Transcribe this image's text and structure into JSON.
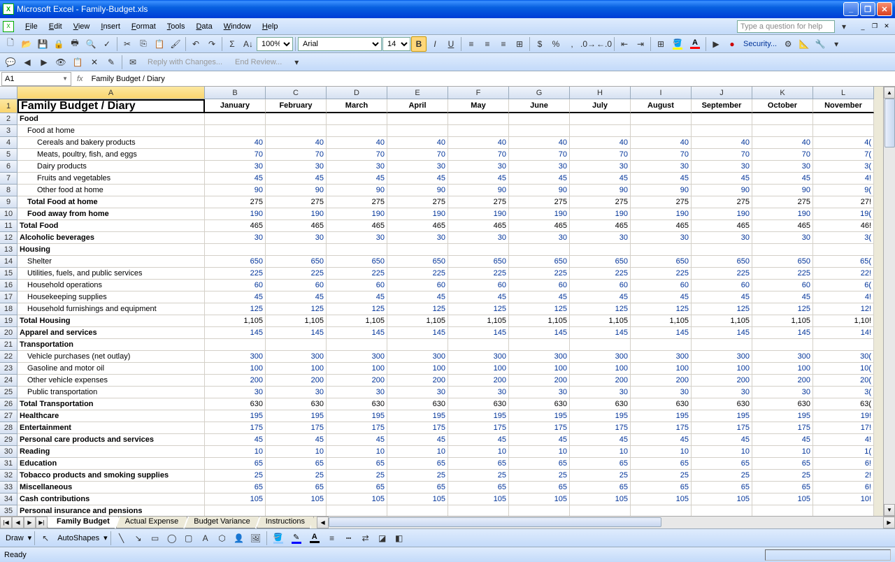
{
  "window": {
    "app": "Microsoft Excel",
    "doc": "Family-Budget.xls",
    "title": "Microsoft Excel - Family-Budget.xls"
  },
  "menus": [
    "File",
    "Edit",
    "View",
    "Insert",
    "Format",
    "Tools",
    "Data",
    "Window",
    "Help"
  ],
  "help_placeholder": "Type a question for help",
  "toolbar": {
    "zoom": "100%",
    "font": "Arial",
    "size": "14",
    "security": "Security..."
  },
  "review": {
    "reply": "Reply with Changes...",
    "end": "End Review..."
  },
  "namebox": "A1",
  "formula": "Family Budget / Diary",
  "columns": [
    "A",
    "B",
    "C",
    "D",
    "E",
    "F",
    "G",
    "H",
    "I",
    "J",
    "K",
    "L"
  ],
  "months": [
    "January",
    "February",
    "March",
    "April",
    "May",
    "June",
    "July",
    "August",
    "September",
    "October",
    "November"
  ],
  "rows": [
    {
      "n": 1,
      "a": "Family Budget / Diary",
      "style": "title"
    },
    {
      "n": 2,
      "a": "Food",
      "bold": true
    },
    {
      "n": 3,
      "a": "Food at home",
      "indent": 1
    },
    {
      "n": 4,
      "a": "Cereals and bakery products",
      "indent": 2,
      "v": 40,
      "last": "4("
    },
    {
      "n": 5,
      "a": "Meats, poultry, fish, and eggs",
      "indent": 2,
      "v": 70,
      "last": "7("
    },
    {
      "n": 6,
      "a": "Dairy products",
      "indent": 2,
      "v": 30,
      "last": "3("
    },
    {
      "n": 7,
      "a": "Fruits and vegetables",
      "indent": 2,
      "v": 45,
      "last": "4!"
    },
    {
      "n": 8,
      "a": "Other food at home",
      "indent": 2,
      "v": 90,
      "last": "9("
    },
    {
      "n": 9,
      "a": "Total Food at home",
      "indent": 1,
      "bold": true,
      "v": 275,
      "black": true,
      "last": "27!"
    },
    {
      "n": 10,
      "a": "Food away from home",
      "indent": 1,
      "bold": true,
      "v": 190,
      "last": "19("
    },
    {
      "n": 11,
      "a": "Total Food",
      "bold": true,
      "v": 465,
      "black": true,
      "last": "46!"
    },
    {
      "n": 12,
      "a": "Alcoholic beverages",
      "bold": true,
      "v": 30,
      "last": "3("
    },
    {
      "n": 13,
      "a": "Housing",
      "bold": true
    },
    {
      "n": 14,
      "a": "Shelter",
      "indent": 1,
      "v": 650,
      "last": "65("
    },
    {
      "n": 15,
      "a": "Utilities, fuels, and public services",
      "indent": 1,
      "v": 225,
      "last": "22!"
    },
    {
      "n": 16,
      "a": "Household operations",
      "indent": 1,
      "v": 60,
      "last": "6("
    },
    {
      "n": 17,
      "a": "Housekeeping supplies",
      "indent": 1,
      "v": 45,
      "last": "4!"
    },
    {
      "n": 18,
      "a": "Household furnishings and equipment",
      "indent": 1,
      "v": 125,
      "last": "12!"
    },
    {
      "n": 19,
      "a": "Total Housing",
      "bold": true,
      "v": "1,105",
      "black": true,
      "last": "1,10!"
    },
    {
      "n": 20,
      "a": "Apparel and services",
      "bold": true,
      "v": 145,
      "last": "14!"
    },
    {
      "n": 21,
      "a": "Transportation",
      "bold": true
    },
    {
      "n": 22,
      "a": "Vehicle purchases (net outlay)",
      "indent": 1,
      "v": 300,
      "last": "30("
    },
    {
      "n": 23,
      "a": "Gasoline and motor oil",
      "indent": 1,
      "v": 100,
      "last": "10("
    },
    {
      "n": 24,
      "a": "Other vehicle expenses",
      "indent": 1,
      "v": 200,
      "last": "20("
    },
    {
      "n": 25,
      "a": "Public transportation",
      "indent": 1,
      "v": 30,
      "last": "3("
    },
    {
      "n": 26,
      "a": "Total Transportation",
      "bold": true,
      "v": 630,
      "black": true,
      "last": "63("
    },
    {
      "n": 27,
      "a": "Healthcare",
      "bold": true,
      "v": 195,
      "last": "19!"
    },
    {
      "n": 28,
      "a": "Entertainment",
      "bold": true,
      "v": 175,
      "last": "17!"
    },
    {
      "n": 29,
      "a": "Personal care products and services",
      "bold": true,
      "v": 45,
      "last": "4!"
    },
    {
      "n": 30,
      "a": "Reading",
      "bold": true,
      "v": 10,
      "last": "1("
    },
    {
      "n": 31,
      "a": "Education",
      "bold": true,
      "v": 65,
      "last": "6!"
    },
    {
      "n": 32,
      "a": "Tobacco products and smoking supplies",
      "bold": true,
      "v": 25,
      "last": "2!"
    },
    {
      "n": 33,
      "a": "Miscellaneous",
      "bold": true,
      "v": 65,
      "last": "6!"
    },
    {
      "n": 34,
      "a": "Cash contributions",
      "bold": true,
      "v": 105,
      "last": "10!"
    },
    {
      "n": 35,
      "a": "Personal insurance and pensions",
      "bold": true
    }
  ],
  "sheet_tabs": [
    "Family Budget",
    "Actual Expense",
    "Budget Variance",
    "Instructions"
  ],
  "active_tab": 0,
  "drawbar": {
    "draw": "Draw",
    "autoshapes": "AutoShapes"
  },
  "status": "Ready"
}
